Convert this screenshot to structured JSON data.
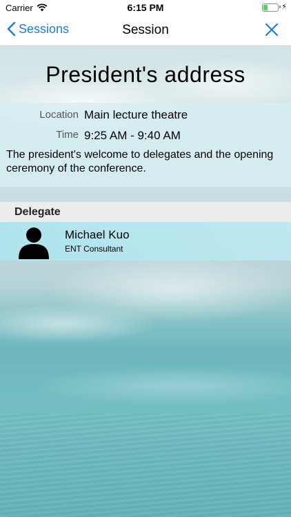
{
  "status_bar": {
    "carrier": "Carrier",
    "time": "6:15 PM",
    "battery_level": 0.3,
    "battery_color": "#4cd964"
  },
  "nav": {
    "back_label": "Sessions",
    "title": "Session",
    "back_icon": "chevron-left-icon",
    "close_icon": "close-icon",
    "accent": "#1a7fd6"
  },
  "session": {
    "title": "President's address",
    "location_label": "Location",
    "location_value": "Main lecture theatre",
    "time_label": "Time",
    "time_value": "9:25 AM - 9:40 AM",
    "description": "The president's welcome to delegates and the opening ceremony of the conference."
  },
  "delegates": {
    "header": "Delegate",
    "items": [
      {
        "name": "Michael Kuo",
        "role": "ENT Consultant",
        "icon": "person-icon"
      }
    ]
  }
}
